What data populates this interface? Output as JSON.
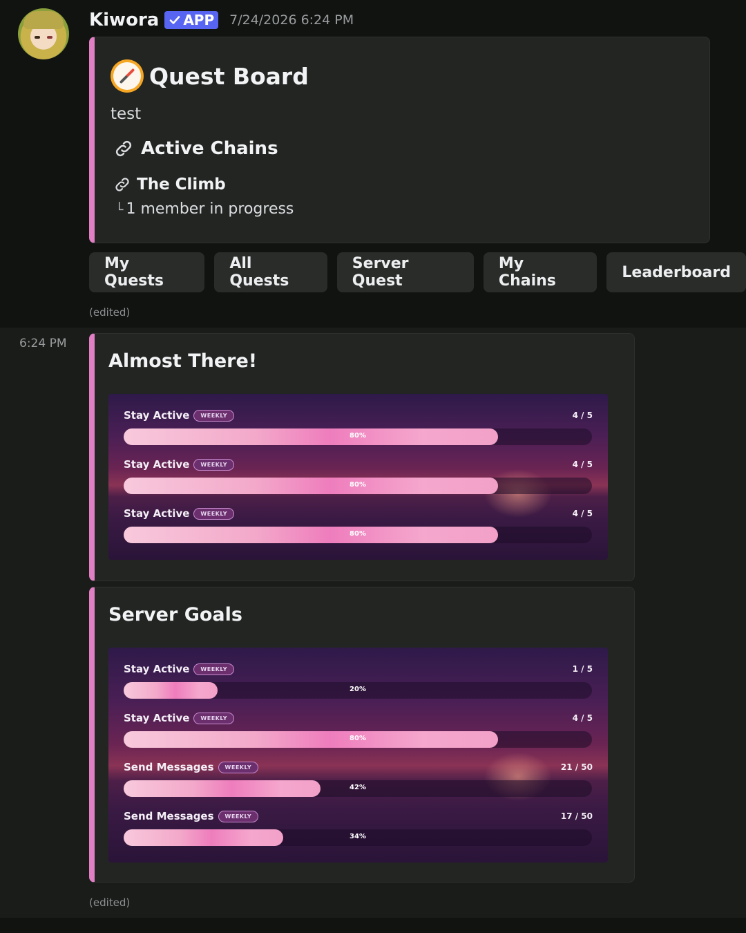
{
  "message": {
    "username": "Kiwora",
    "app_badge": "APP",
    "timestamp": "7/24/2026 6:24 PM",
    "edited_label": "(edited)"
  },
  "quest_board": {
    "title": "Quest Board",
    "description": "test",
    "field_name": "Active Chains",
    "chain_name": "The Climb",
    "chain_tree": "└",
    "chain_detail": "1 member in progress"
  },
  "buttons": [
    "My Quests",
    "All Quests",
    "Server Quest",
    "My Chains",
    "Leaderboard"
  ],
  "followup": {
    "side_time": "6:24 PM",
    "edited_label": "(edited)"
  },
  "almost_there": {
    "title": "Almost There!",
    "quests": [
      {
        "name": "Stay Active",
        "badge": "WEEKLY",
        "count": "4 / 5",
        "percent": "80%",
        "progress": 0.8
      },
      {
        "name": "Stay Active",
        "badge": "WEEKLY",
        "count": "4 / 5",
        "percent": "80%",
        "progress": 0.8
      },
      {
        "name": "Stay Active",
        "badge": "WEEKLY",
        "count": "4 / 5",
        "percent": "80%",
        "progress": 0.8
      }
    ]
  },
  "server_goals": {
    "title": "Server Goals",
    "quests": [
      {
        "name": "Stay Active",
        "badge": "WEEKLY",
        "count": "1 / 5",
        "percent": "20%",
        "progress": 0.2
      },
      {
        "name": "Stay Active",
        "badge": "WEEKLY",
        "count": "4 / 5",
        "percent": "80%",
        "progress": 0.8
      },
      {
        "name": "Send Messages",
        "badge": "WEEKLY",
        "count": "21 / 50",
        "percent": "42%",
        "progress": 0.42
      },
      {
        "name": "Send Messages",
        "badge": "WEEKLY",
        "count": "17 / 50",
        "percent": "34%",
        "progress": 0.34
      }
    ]
  },
  "colors": {
    "accent": "#e07fc4",
    "app_badge": "#5865f2",
    "progress_fill": "#ee7dbd"
  },
  "icons": {
    "title_icon": "compass-icon",
    "field_icon": "link-icon",
    "chain_icon": "link-icon",
    "badge_icon": "checkmark-icon"
  }
}
